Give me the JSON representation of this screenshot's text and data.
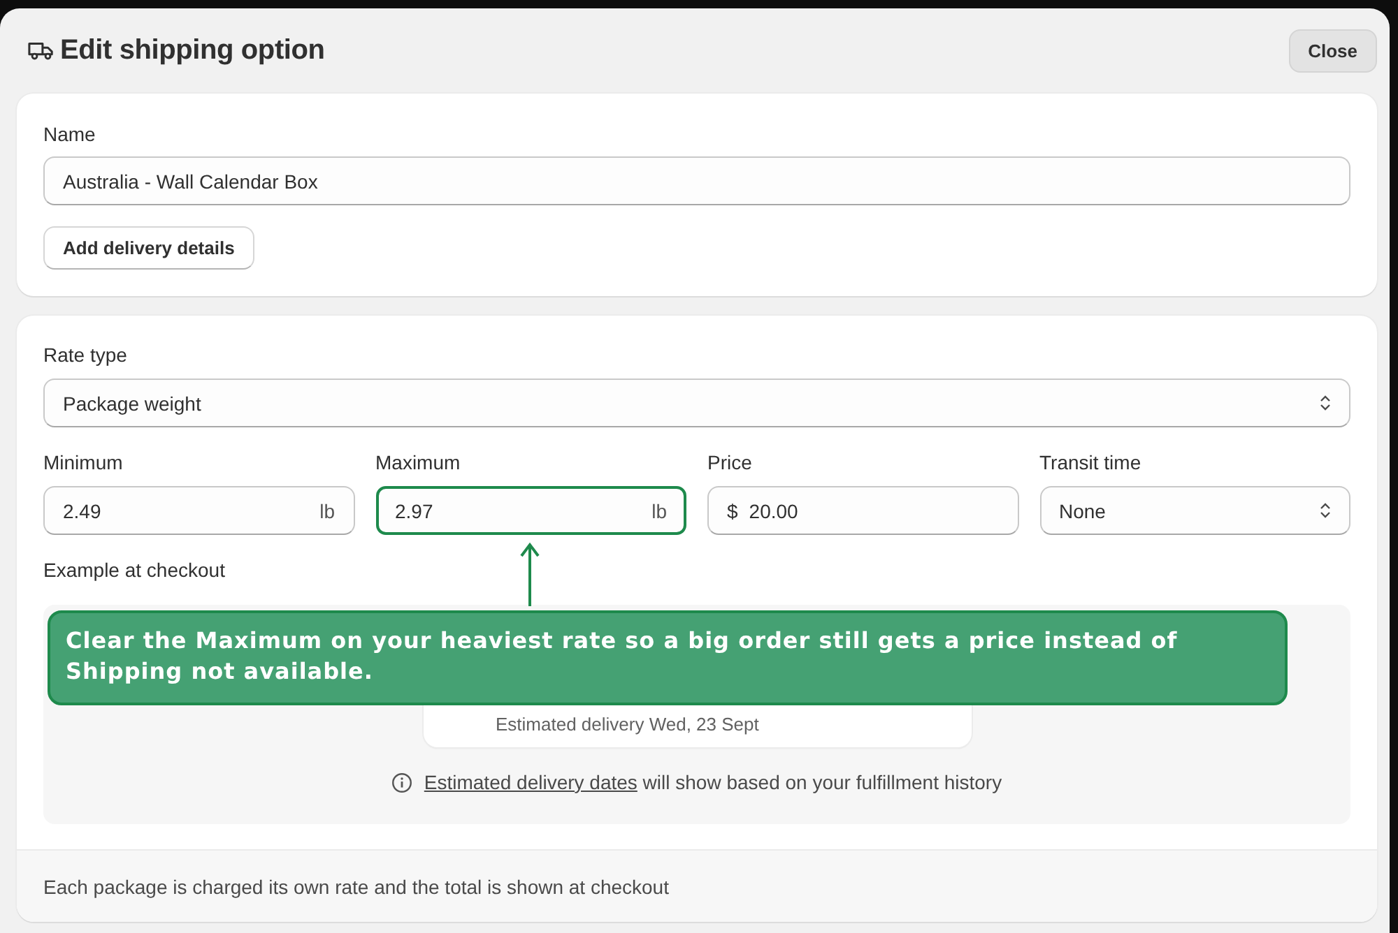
{
  "dialog": {
    "title": "Edit shipping option",
    "close_button": "Close"
  },
  "name_section": {
    "label": "Name",
    "value": "Australia - Wall Calendar Box",
    "button": "Add delivery details"
  },
  "rate_section": {
    "rate_type": {
      "label": "Rate type",
      "value": "Package weight"
    },
    "fields": [
      {
        "kind": "number",
        "label": "Minimum",
        "value": "2.49",
        "suffix": "lb",
        "highlighted": false
      },
      {
        "kind": "number",
        "label": "Maximum",
        "value": "2.97",
        "suffix": "lb",
        "highlighted": true
      },
      {
        "kind": "currency",
        "label": "Price",
        "prefix": "$",
        "value": "20.00",
        "highlighted": false
      },
      {
        "kind": "select",
        "label": "Transit time",
        "value": "None",
        "highlighted": false
      }
    ],
    "checkout_example": {
      "label": "Example at checkout",
      "estimated_delivery": "Estimated delivery Wed, 23 Sept",
      "note_link": "Estimated delivery dates",
      "note_text": "will show based on your fulfillment history"
    },
    "footer": "Each package is charged its own rate and the total is shown at checkout"
  },
  "annotation": {
    "text": "Clear the Maximum on your heaviest rate so a big order still gets a price instead of Shipping not available."
  }
}
